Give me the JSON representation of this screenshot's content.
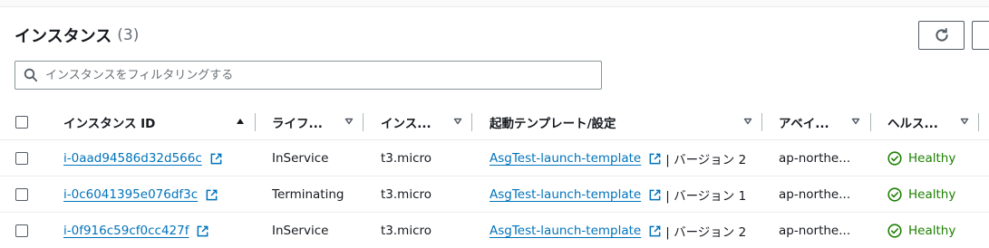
{
  "header": {
    "title": "インスタンス",
    "count": "(3)"
  },
  "search": {
    "placeholder": "インスタンスをフィルタリングする"
  },
  "columns": [
    {
      "label": "インスタンス ID",
      "sort_icon": "sort-ascending-icon"
    },
    {
      "label": "ライフ...",
      "sort_icon": "sort-descending-icon"
    },
    {
      "label": "インス...",
      "sort_icon": "sort-descending-icon"
    },
    {
      "label": "起動テンプレート/設定",
      "sort_icon": "sort-descending-icon"
    },
    {
      "label": "アベイ...",
      "sort_icon": "sort-descending-icon"
    },
    {
      "label": "ヘルス...",
      "sort_icon": "sort-descending-icon"
    }
  ],
  "rows": [
    {
      "instance_id": "i-0aad94586d32d566c",
      "lifecycle": "InService",
      "instance_type": "t3.micro",
      "launch_template": "AsgTest-launch-template",
      "version": "| バージョン 2",
      "az": "ap-northe...",
      "health": "Healthy"
    },
    {
      "instance_id": "i-0c6041395e076df3c",
      "lifecycle": "Terminating",
      "instance_type": "t3.micro",
      "launch_template": "AsgTest-launch-template",
      "version": "| バージョン 1",
      "az": "ap-northe...",
      "health": "Healthy"
    },
    {
      "instance_id": "i-0f916c59cf0cc427f",
      "lifecycle": "InService",
      "instance_type": "t3.micro",
      "launch_template": "AsgTest-launch-template",
      "version": "| バージョン 2",
      "az": "ap-northe...",
      "health": "Healthy"
    }
  ],
  "colors": {
    "link": "#0073bb",
    "healthy": "#1d8102",
    "text": "#16191f",
    "muted": "#687078"
  }
}
